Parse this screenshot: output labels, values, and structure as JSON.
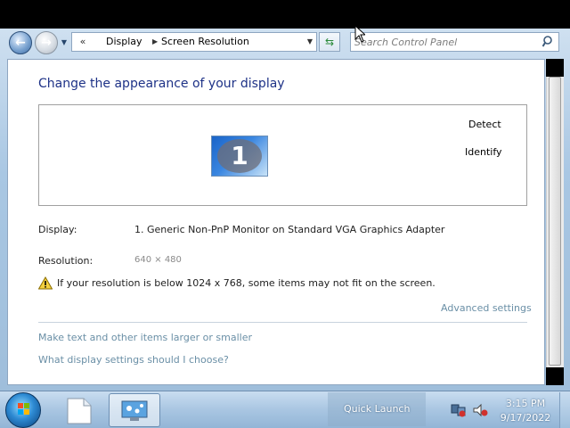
{
  "nav": {
    "breadcrumb": [
      "Display",
      "Screen Resolution"
    ],
    "search_placeholder": "Search Control Panel"
  },
  "main": {
    "title": "Change the appearance of your display",
    "monitor_number": "1",
    "detect_label": "Detect",
    "identify_label": "Identify",
    "display_label": "Display:",
    "display_value": "1. Generic Non-PnP Monitor on Standard VGA Graphics Adapter",
    "resolution_label": "Resolution:",
    "resolution_value": "640 × 480",
    "warning_text": "If your resolution is below 1024 x 768, some items may not fit on the screen.",
    "advanced_link": "Advanced settings",
    "links": [
      "Make text and other items larger or smaller",
      "What display settings should I choose?"
    ]
  },
  "taskbar": {
    "quick_launch": "Quick Launch",
    "time": "3:15 PM",
    "date": "9/17/2022"
  },
  "colors": {
    "title_blue": "#1e3287",
    "link": "#6a8fa6",
    "taskbar": "#a9c6e2"
  }
}
